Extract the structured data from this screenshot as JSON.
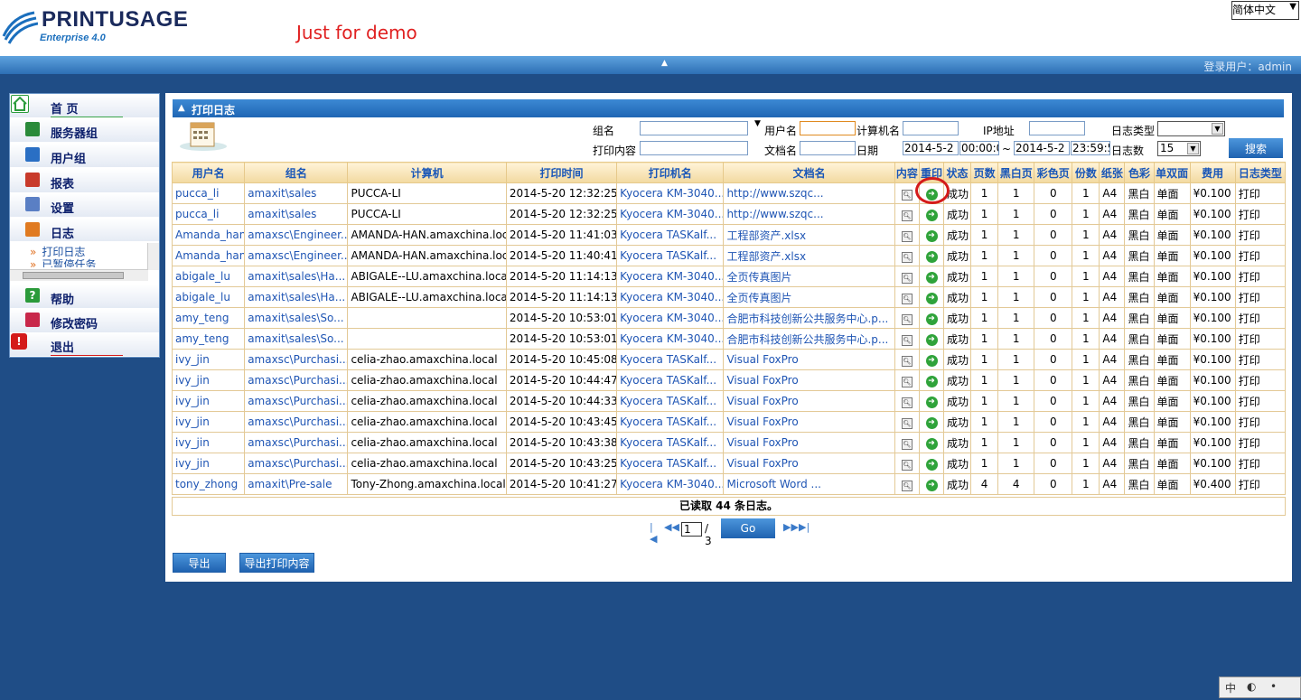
{
  "header": {
    "logo_title": "PRINTUSAGE",
    "logo_subtitle": "Enterprise 4.0",
    "demo_note": "Just for demo",
    "language": "简体中文",
    "login_label": "登录用户：admin"
  },
  "sidebar": {
    "items": [
      {
        "label": "首 页",
        "icon": "home-icon"
      },
      {
        "label": "服务器组",
        "icon": "server-group-icon"
      },
      {
        "label": "用户组",
        "icon": "user-group-icon"
      },
      {
        "label": "报表",
        "icon": "report-icon"
      },
      {
        "label": "设置",
        "icon": "settings-icon"
      },
      {
        "label": "日志",
        "icon": "log-icon"
      },
      {
        "label": "帮助",
        "icon": "help-icon"
      },
      {
        "label": "修改密码",
        "icon": "password-icon"
      },
      {
        "label": "退出",
        "icon": "logout-icon"
      }
    ],
    "submenu": [
      {
        "label": "打印日志"
      },
      {
        "label": "已暂停任务"
      }
    ]
  },
  "panel": {
    "title": "打印日志"
  },
  "filters": {
    "group_label": "组名",
    "group_value": "",
    "user_label": "用户名",
    "user_value": "",
    "computer_label": "计算机名",
    "computer_value": "",
    "ip_label": "IP地址",
    "ip_value": "",
    "log_type_label": "日志类型",
    "log_type_value": "",
    "content_label": "打印内容",
    "content_value": "",
    "docname_label": "文档名",
    "docname_value": "",
    "date_label": "日期",
    "date_from": "2014-5-2",
    "time_from": "00:00:0",
    "date_sep": "~",
    "date_to": "2014-5-2",
    "time_to": "23:59:5",
    "count_label": "日志数",
    "count_value": "15",
    "search_label": "搜索"
  },
  "table": {
    "columns": [
      "用户名",
      "组名",
      "计算机",
      "打印时间",
      "打印机名",
      "文档名",
      "内容",
      "重印",
      "状态",
      "页数",
      "黑白页",
      "彩色页",
      "份数",
      "纸张",
      "色彩",
      "单双面",
      "费用",
      "日志类型"
    ],
    "rows": [
      [
        "pucca_li",
        "amaxit\\sales",
        "PUCCA-LI",
        "2014-5-20 12:32:25",
        "Kyocera KM-3040...",
        "http://www.szqc...",
        "",
        "",
        "成功",
        "1",
        "1",
        "0",
        "1",
        "A4",
        "黑白",
        "单面",
        "¥0.100",
        "打印"
      ],
      [
        "pucca_li",
        "amaxit\\sales",
        "PUCCA-LI",
        "2014-5-20 12:32:25",
        "Kyocera KM-3040...",
        "http://www.szqc...",
        "",
        "",
        "成功",
        "1",
        "1",
        "0",
        "1",
        "A4",
        "黑白",
        "单面",
        "¥0.100",
        "打印"
      ],
      [
        "Amanda_han",
        "amaxsc\\Engineer...",
        "AMANDA-HAN.amaxchina.local",
        "2014-5-20 11:41:03",
        "Kyocera TASKalf...",
        "工程部资产.xlsx",
        "",
        "",
        "成功",
        "1",
        "1",
        "0",
        "1",
        "A4",
        "黑白",
        "单面",
        "¥0.100",
        "打印"
      ],
      [
        "Amanda_han",
        "amaxsc\\Engineer...",
        "AMANDA-HAN.amaxchina.local",
        "2014-5-20 11:40:41",
        "Kyocera TASKalf...",
        "工程部资产.xlsx",
        "",
        "",
        "成功",
        "1",
        "1",
        "0",
        "1",
        "A4",
        "黑白",
        "单面",
        "¥0.100",
        "打印"
      ],
      [
        "abigale_lu",
        "amaxit\\sales\\Ha...",
        "ABIGALE--LU.amaxchina.local",
        "2014-5-20 11:14:13",
        "Kyocera KM-3040...",
        "全页传真图片",
        "",
        "",
        "成功",
        "1",
        "1",
        "0",
        "1",
        "A4",
        "黑白",
        "单面",
        "¥0.100",
        "打印"
      ],
      [
        "abigale_lu",
        "amaxit\\sales\\Ha...",
        "ABIGALE--LU.amaxchina.local",
        "2014-5-20 11:14:13",
        "Kyocera KM-3040...",
        "全页传真图片",
        "",
        "",
        "成功",
        "1",
        "1",
        "0",
        "1",
        "A4",
        "黑白",
        "单面",
        "¥0.100",
        "打印"
      ],
      [
        "amy_teng",
        "amaxit\\sales\\So...",
        "",
        "2014-5-20 10:53:01",
        "Kyocera KM-3040...",
        "合肥市科技创新公共服务中心.p...",
        "",
        "",
        "成功",
        "1",
        "1",
        "0",
        "1",
        "A4",
        "黑白",
        "单面",
        "¥0.100",
        "打印"
      ],
      [
        "amy_teng",
        "amaxit\\sales\\So...",
        "",
        "2014-5-20 10:53:01",
        "Kyocera KM-3040...",
        "合肥市科技创新公共服务中心.p...",
        "",
        "",
        "成功",
        "1",
        "1",
        "0",
        "1",
        "A4",
        "黑白",
        "单面",
        "¥0.100",
        "打印"
      ],
      [
        "ivy_jin",
        "amaxsc\\Purchasi...",
        "celia-zhao.amaxchina.local",
        "2014-5-20 10:45:08",
        "Kyocera TASKalf...",
        "Visual FoxPro",
        "",
        "",
        "成功",
        "1",
        "1",
        "0",
        "1",
        "A4",
        "黑白",
        "单面",
        "¥0.100",
        "打印"
      ],
      [
        "ivy_jin",
        "amaxsc\\Purchasi...",
        "celia-zhao.amaxchina.local",
        "2014-5-20 10:44:47",
        "Kyocera TASKalf...",
        "Visual FoxPro",
        "",
        "",
        "成功",
        "1",
        "1",
        "0",
        "1",
        "A4",
        "黑白",
        "单面",
        "¥0.100",
        "打印"
      ],
      [
        "ivy_jin",
        "amaxsc\\Purchasi...",
        "celia-zhao.amaxchina.local",
        "2014-5-20 10:44:33",
        "Kyocera TASKalf...",
        "Visual FoxPro",
        "",
        "",
        "成功",
        "1",
        "1",
        "0",
        "1",
        "A4",
        "黑白",
        "单面",
        "¥0.100",
        "打印"
      ],
      [
        "ivy_jin",
        "amaxsc\\Purchasi...",
        "celia-zhao.amaxchina.local",
        "2014-5-20 10:43:45",
        "Kyocera TASKalf...",
        "Visual FoxPro",
        "",
        "",
        "成功",
        "1",
        "1",
        "0",
        "1",
        "A4",
        "黑白",
        "单面",
        "¥0.100",
        "打印"
      ],
      [
        "ivy_jin",
        "amaxsc\\Purchasi...",
        "celia-zhao.amaxchina.local",
        "2014-5-20 10:43:38",
        "Kyocera TASKalf...",
        "Visual FoxPro",
        "",
        "",
        "成功",
        "1",
        "1",
        "0",
        "1",
        "A4",
        "黑白",
        "单面",
        "¥0.100",
        "打印"
      ],
      [
        "ivy_jin",
        "amaxsc\\Purchasi...",
        "celia-zhao.amaxchina.local",
        "2014-5-20 10:43:25",
        "Kyocera TASKalf...",
        "Visual FoxPro",
        "",
        "",
        "成功",
        "1",
        "1",
        "0",
        "1",
        "A4",
        "黑白",
        "单面",
        "¥0.100",
        "打印"
      ],
      [
        "tony_zhong",
        "amaxit\\Pre-sale",
        "Tony-Zhong.amaxchina.local",
        "2014-5-20 10:41:27",
        "Kyocera KM-3040...",
        "Microsoft Word ...",
        "",
        "",
        "成功",
        "4",
        "4",
        "0",
        "1",
        "A4",
        "黑白",
        "单面",
        "¥0.400",
        "打印"
      ]
    ],
    "summary_prefix": "已读取",
    "summary_count": "44",
    "summary_suffix": "条日志。"
  },
  "pager": {
    "current_page": "1",
    "total": "/ 3",
    "go_label": "Go"
  },
  "actions": {
    "export_label": "导出",
    "export_content_label": "导出打印内容"
  },
  "bottom_tools": [
    "中",
    "◐",
    "•"
  ],
  "colors": {
    "background": "#1f4d86",
    "accent": "#2a72c4",
    "link": "#1f55b4",
    "highlight": "#d41a1a"
  }
}
